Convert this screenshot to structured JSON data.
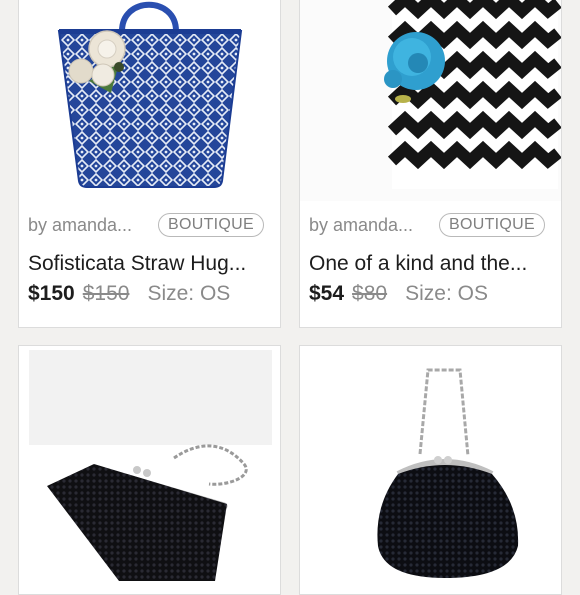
{
  "listings": [
    {
      "seller": "by amanda...",
      "badge": "BOUTIQUE",
      "title": "Sofisticata Straw Hug...",
      "price": "$150",
      "original_price": "$150",
      "size": "Size: OS",
      "image": "blue-white-woven-tote-with-fabric-flowers"
    },
    {
      "seller": "by amanda...",
      "badge": "BOUTIQUE",
      "title": "One of a kind and the...",
      "price": "$54",
      "original_price": "$80",
      "size": "Size: OS",
      "image": "black-white-chevron-tote-with-blue-flower"
    },
    {
      "image": "black-sequin-clutch-with-chain"
    },
    {
      "image": "black-sequin-pouch-with-chain"
    }
  ],
  "colors": {
    "background": "#f2f1ef",
    "card": "#ffffff",
    "tote_blue": "#23479b",
    "flower_blue": "#2f9fcf",
    "chevron_black": "#151515"
  }
}
